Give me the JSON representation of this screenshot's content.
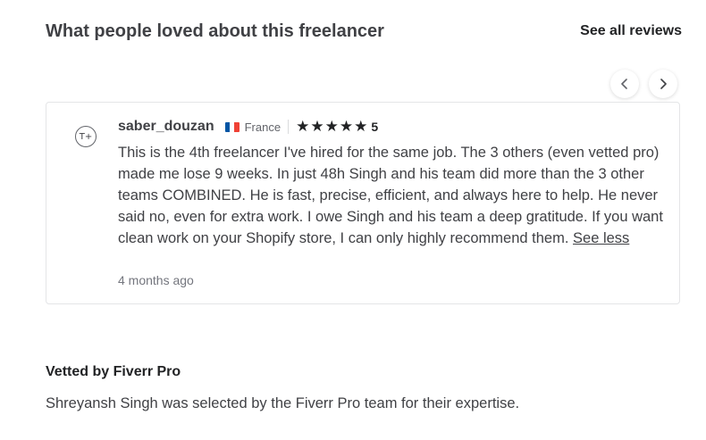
{
  "reviews_section": {
    "title": "What people loved about this freelancer",
    "see_all_label": "See all reviews",
    "carousel": {
      "prev_icon": "chevron-left-icon",
      "next_icon": "chevron-right-icon"
    }
  },
  "review": {
    "avatar_initials": "T+",
    "reviewer_name": "saber_douzan",
    "country_flag": "france-flag-icon",
    "country": "France",
    "star_icon": "star-icon",
    "stars": 5,
    "rating": "5",
    "text": "This is the 4th freelancer I've hired for the same job. The 3 others (even vetted pro) made me lose 9 weeks. In just 48h Singh and his team did more than the 3 other teams COMBINED. He is fast, precise, efficient, and always here to help. He never said no, even for extra work. I owe Singh and his team a deep gratitude. If you want clean work on your Shopify store, I can only highly recommend them.",
    "see_less_label": "See less",
    "time_ago": "4 months ago"
  },
  "vetted": {
    "title": "Vetted by Fiverr Pro",
    "description": "Shreyansh Singh was selected by the Fiverr Pro team for their expertise."
  },
  "colors": {
    "text_primary": "#404145",
    "text_muted": "#74767e",
    "border": "#e4e5e7",
    "flag_blue": "#0055a4",
    "flag_white": "#ffffff",
    "flag_red": "#ef4135"
  }
}
